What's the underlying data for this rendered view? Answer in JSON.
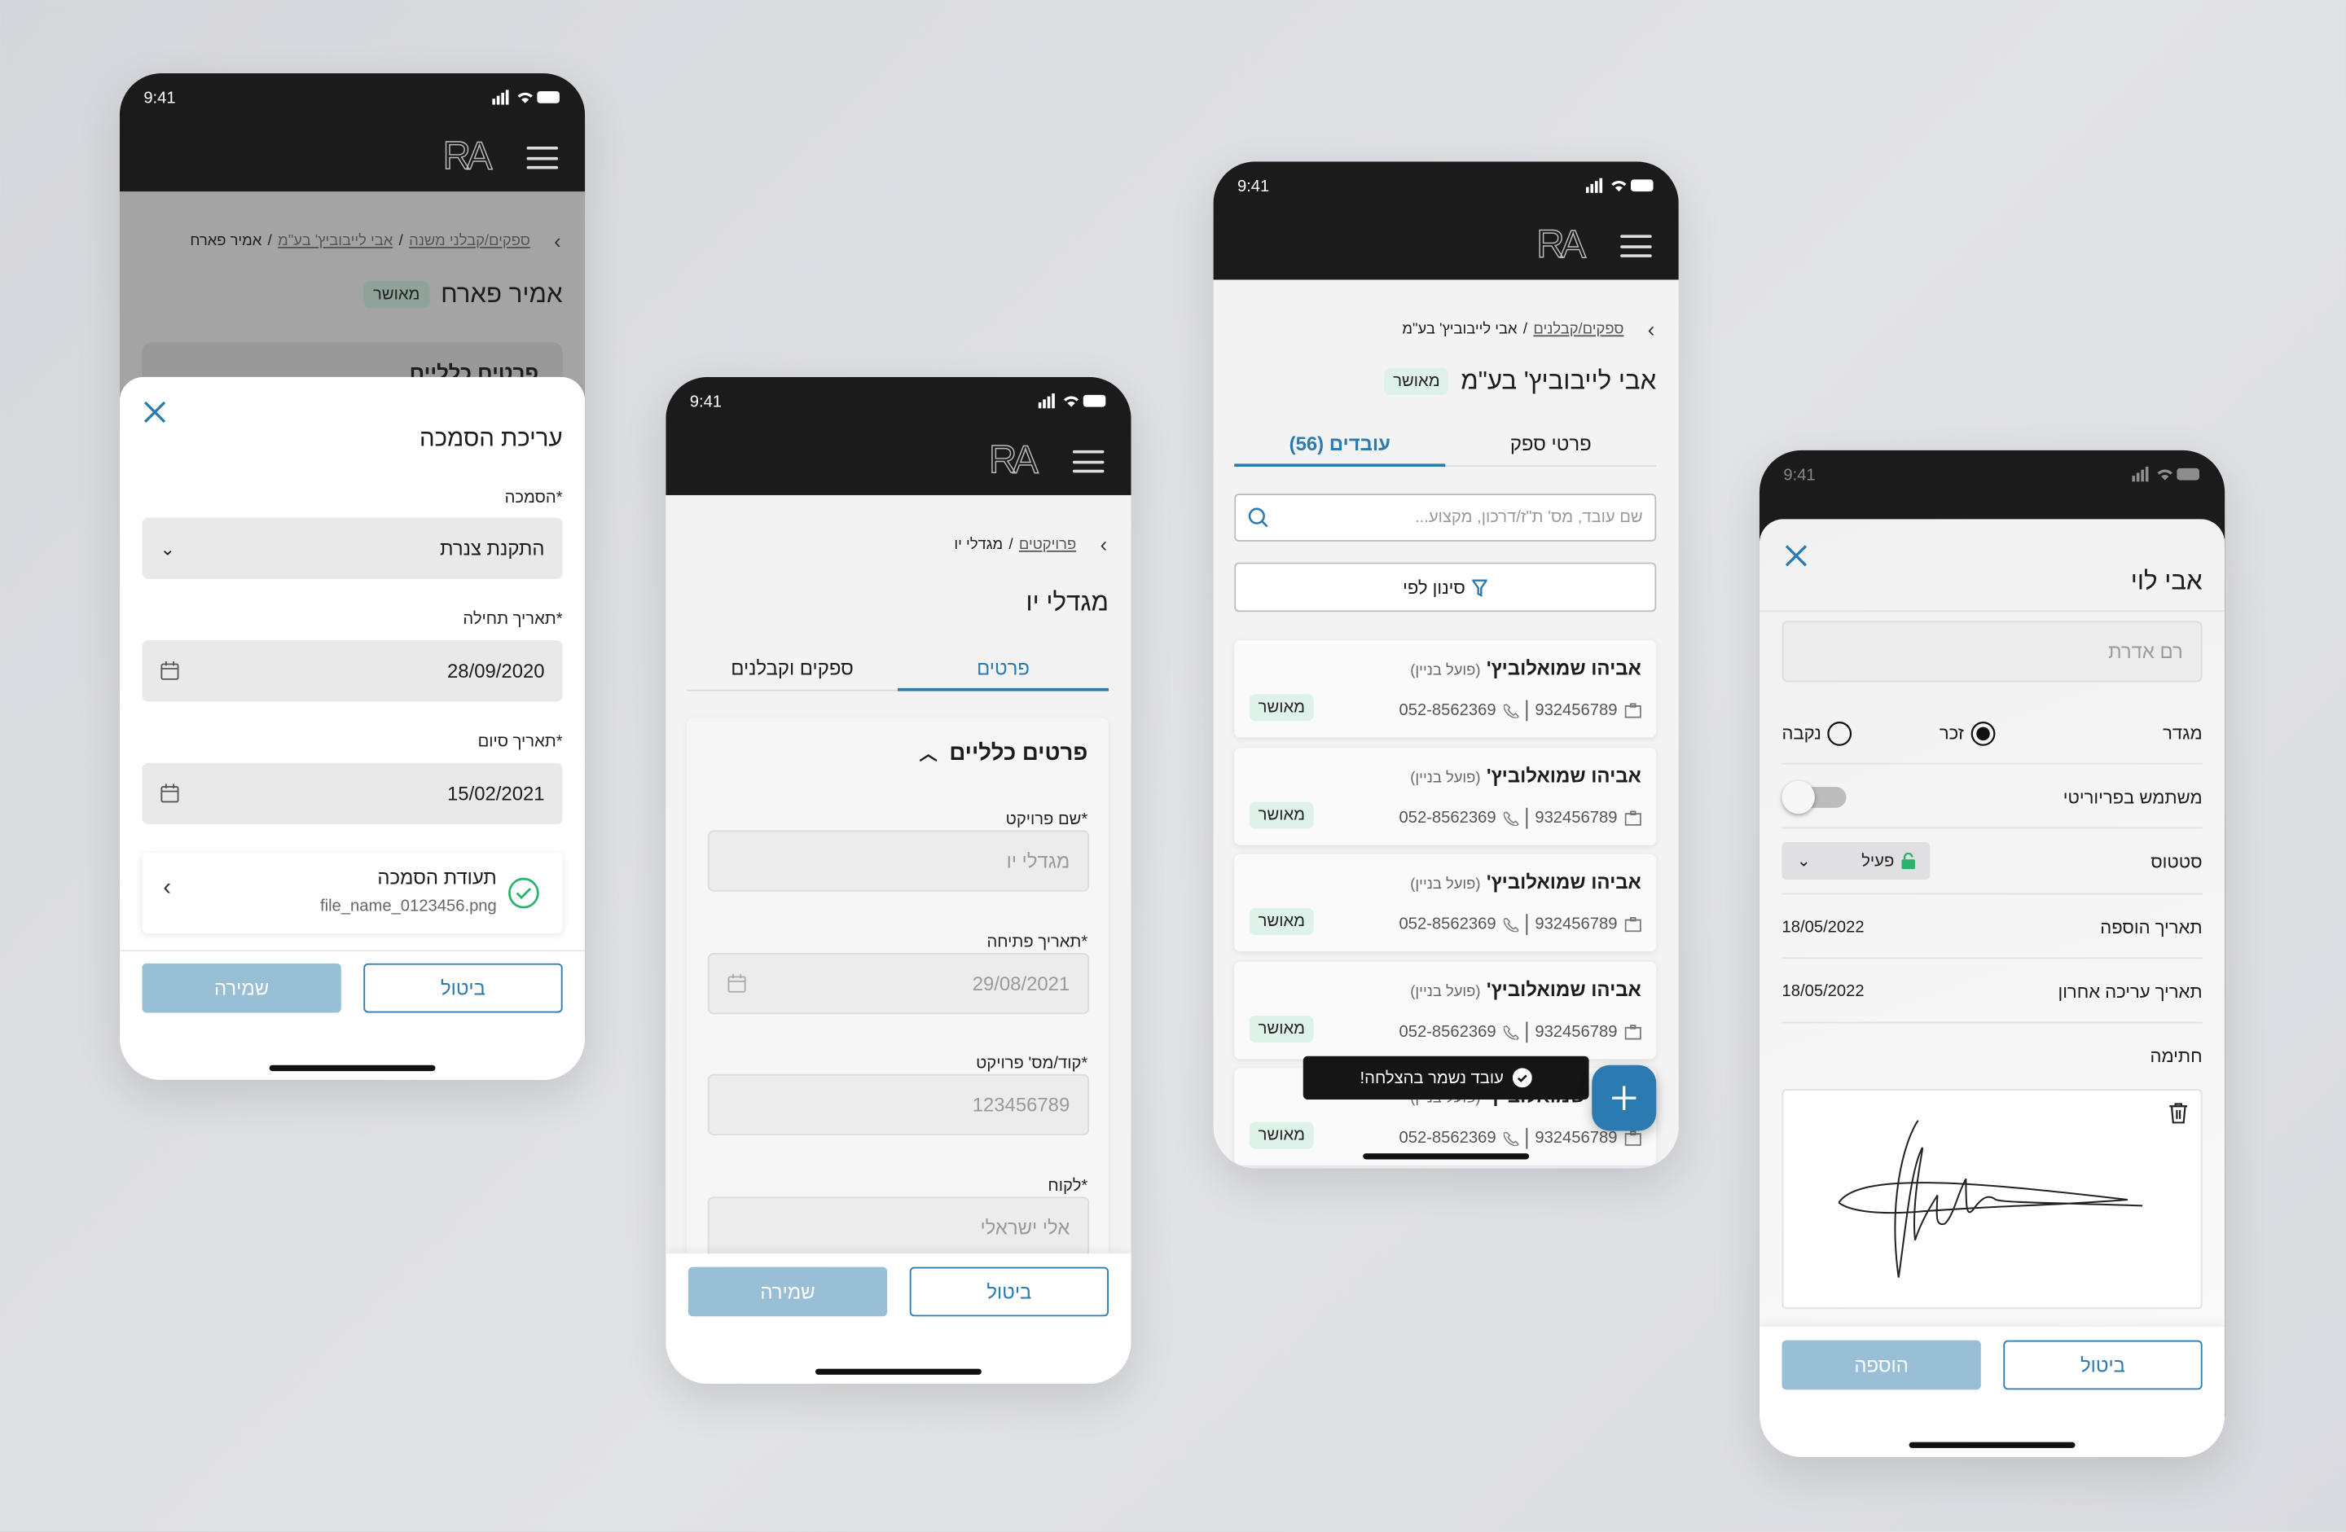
{
  "status_bar": {
    "time": "9:41"
  },
  "logo": "RA",
  "colors": {
    "accent": "#2b7bb0",
    "primary_disabled": "#98bfd6",
    "badge_bg": "#dff2ea",
    "success": "#2bb36b",
    "header": "#1b1b1b"
  },
  "screen1": {
    "breadcrumb": [
      "ספקים/קבלני משנה",
      "אבי לייבוביץ' בע\"מ",
      "אמיר פארח"
    ],
    "title": "אמיר פארח",
    "badge": "מאושר",
    "hidden_card_title": "פרטים כלליים",
    "sheet": {
      "title": "עריכת הסמכה",
      "cert_label": "*הסמכה",
      "cert_value": "התקנת צנרת",
      "start_label": "*תאריך תחילה",
      "start_value": "28/09/2020",
      "end_label": "*תאריך סיום",
      "end_value": "15/02/2021",
      "file_title": "תעודת הסמכה",
      "file_name": "file_name_0123456.png",
      "save": "שמירה",
      "cancel": "ביטול"
    }
  },
  "screen2": {
    "breadcrumb": [
      "פרויקטים",
      "מגדלי יו"
    ],
    "title": "מגדלי יו",
    "tabs": [
      "פרטים",
      "ספקים וקבלנים"
    ],
    "section_title": "פרטים כלליים",
    "fields": [
      {
        "label": "*שם פרויקט",
        "value": "מגדלי יו"
      },
      {
        "label": "*תאריך פתיחה",
        "value": "29/08/2021"
      },
      {
        "label": "*קוד/מס' פרויקט",
        "value": "123456789"
      },
      {
        "label": "*לקוח",
        "value": "אלי ישראלי"
      }
    ],
    "save": "שמירה",
    "cancel": "ביטול"
  },
  "screen3": {
    "breadcrumb": [
      "ספקים/קבלנים",
      "אבי לייבוביץ' בע\"מ"
    ],
    "title": "אבי לייבוביץ' בע\"מ",
    "badge": "מאושר",
    "tabs": [
      "פרטי ספק",
      "עובדים (56)"
    ],
    "search_placeholder": "שם עובד, מס' ת\"ז/דרכון, מקצוע...",
    "filter": "סינון לפי",
    "employees": [
      {
        "name": "אביהו שמואלוביץ'",
        "role": "(פועל בניין)",
        "id": "932456789",
        "phone": "052-8562369",
        "status": "מאושר"
      },
      {
        "name": "אביהו שמואלוביץ'",
        "role": "(פועל בניין)",
        "id": "932456789",
        "phone": "052-8562369",
        "status": "מאושר"
      },
      {
        "name": "אביהו שמואלוביץ'",
        "role": "(פועל בניין)",
        "id": "932456789",
        "phone": "052-8562369",
        "status": "מאושר"
      },
      {
        "name": "אביהו שמואלוביץ'",
        "role": "(פועל בניין)",
        "id": "932456789",
        "phone": "052-8562369",
        "status": "מאושר"
      },
      {
        "name": "אביהו שמואלוביץ'",
        "role": "(פועל בניין)",
        "id": "932456789",
        "phone": "052-8562369",
        "status": "מאושר"
      }
    ],
    "toast": "עובד נשמר בהצלחה!"
  },
  "screen4": {
    "title": "אבי לוי",
    "name_placeholder": "רם אדרת",
    "gender_label": "מגדר",
    "gender_options": [
      "זכר",
      "נקבה"
    ],
    "gender_selected": "זכר",
    "priority_label": "משתמש בפריוריטי",
    "priority_on": false,
    "status_label": "סטטוס",
    "status_value": "פעיל",
    "added_label": "תאריך הוספה",
    "added_value": "18/05/2022",
    "edited_label": "תאריך עריכה אחרון",
    "edited_value": "18/05/2022",
    "signature_label": "חתימה",
    "add": "הוספה",
    "cancel": "ביטול"
  }
}
